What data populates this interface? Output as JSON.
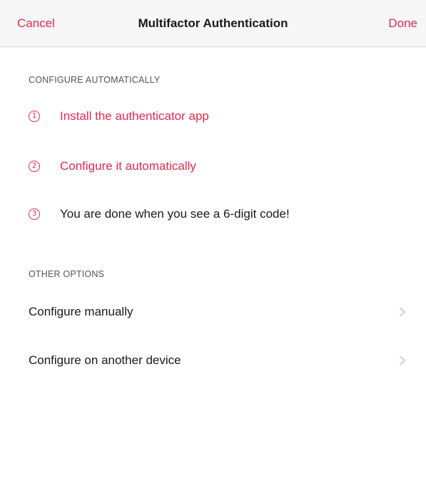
{
  "navbar": {
    "cancel_label": "Cancel",
    "title": "Multifactor Authentication",
    "done_label": "Done"
  },
  "configure_auto": {
    "header": "CONFIGURE AUTOMATICALLY",
    "steps": [
      {
        "number": "1",
        "label": "Install the authenticator app",
        "style": "link"
      },
      {
        "number": "2",
        "label": "Configure it automatically",
        "style": "link"
      },
      {
        "number": "3",
        "label": "You are done when you see a 6-digit code!",
        "style": "plain"
      }
    ]
  },
  "other_options": {
    "header": "OTHER OPTIONS",
    "items": [
      {
        "label": "Configure manually",
        "icon": "chevron-right-icon"
      },
      {
        "label": "Configure on another device",
        "icon": "chevron-right-icon"
      }
    ]
  },
  "colors": {
    "accent": "#e8294e",
    "text": "#1a1a1a",
    "secondary_text": "#555555",
    "navbar_bg": "#f7f7f7",
    "chevron": "#c7c7cc"
  }
}
